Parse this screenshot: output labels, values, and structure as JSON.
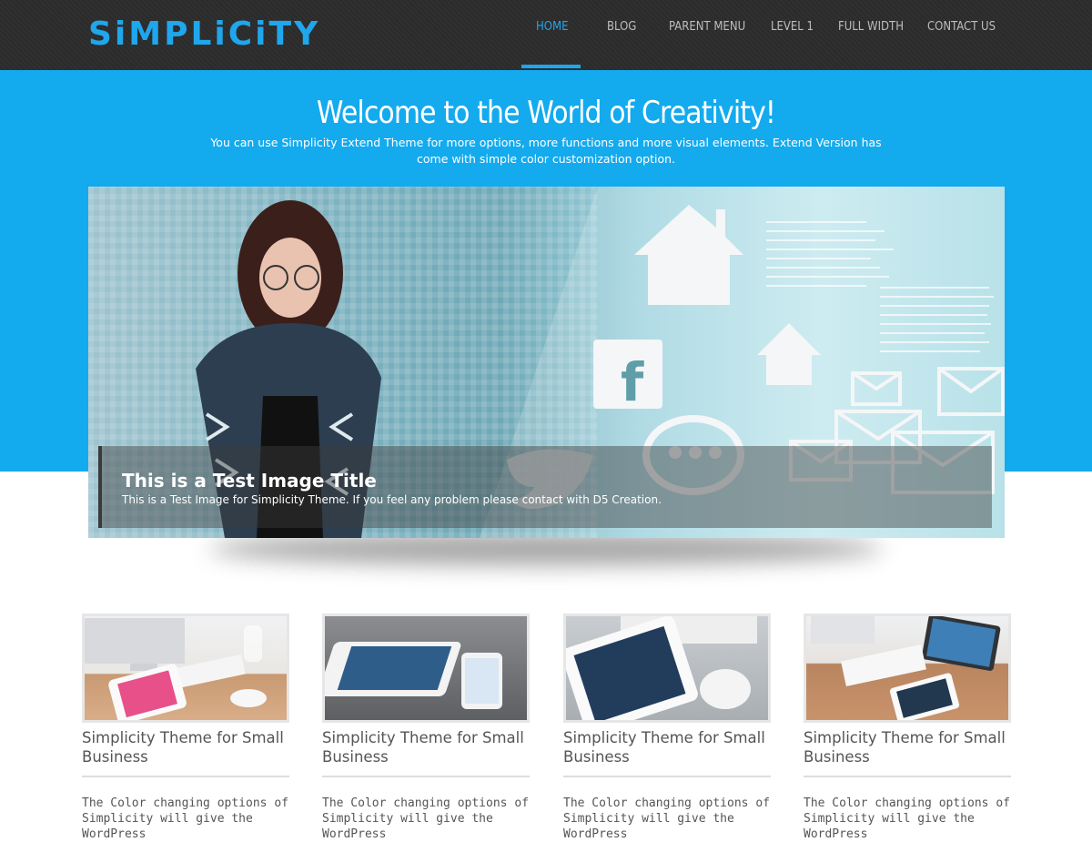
{
  "header": {
    "logo": "SiMPLiCiTY",
    "nav": [
      {
        "label": "HOME",
        "active": true
      },
      {
        "label": "BLOG",
        "active": false
      },
      {
        "label": "PARENT MENU",
        "active": false
      },
      {
        "label": "LEVEL 1",
        "active": false
      },
      {
        "label": "FULL WIDTH",
        "active": false
      },
      {
        "label": "CONTACT US",
        "active": false
      }
    ]
  },
  "hero": {
    "title": "Welcome to the World of Creativity!",
    "subtitle": "You can use Simplicity Extend Theme for more options, more functions and more visual elements. Extend Version has come with simple color customization option."
  },
  "slider": {
    "caption_title": "This is a Test Image Title",
    "caption_text": "This is a Test Image for Simplicity Theme. If you feel any problem please contact with D5 Creation."
  },
  "features": [
    {
      "title": "Simplicity Theme for Small Business",
      "text": "The Color changing options of Simplicity will give the WordPress"
    },
    {
      "title": "Simplicity Theme for Small Business",
      "text": "The Color changing options of Simplicity will give the WordPress"
    },
    {
      "title": "Simplicity Theme for Small Business",
      "text": "The Color changing options of Simplicity will give the WordPress"
    },
    {
      "title": "Simplicity Theme for Small Business",
      "text": "The Color changing options of Simplicity will give the WordPress"
    }
  ],
  "colors": {
    "accent": "#1fa6ec",
    "header_bg": "#2b2b2b",
    "hero_bg": "#14aaee"
  }
}
